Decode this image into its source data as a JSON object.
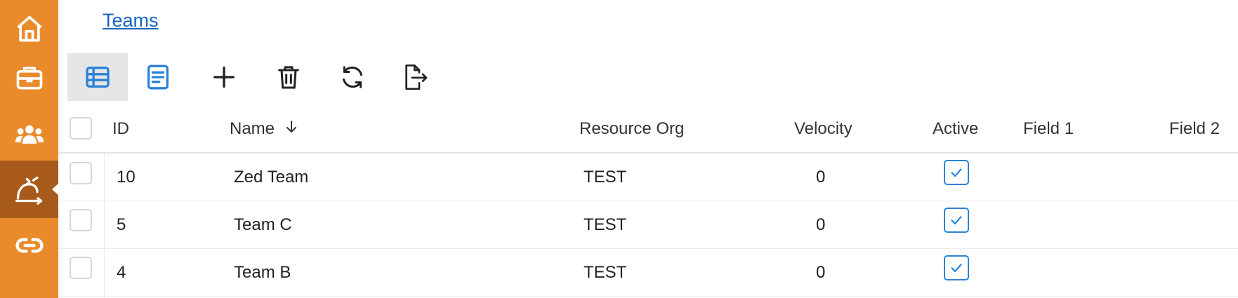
{
  "sidebar": {
    "bg_color": "#ea8b2b",
    "active_color": "#a85a1b",
    "items": [
      {
        "icon": "home-icon"
      },
      {
        "icon": "briefcase-icon"
      },
      {
        "icon": "users-icon"
      },
      {
        "icon": "workflow-icon",
        "active": true
      },
      {
        "icon": "link-icon"
      }
    ]
  },
  "breadcrumb": {
    "label": "Teams"
  },
  "toolbar": {
    "buttons": [
      {
        "icon": "table-view-icon",
        "active": true
      },
      {
        "icon": "form-view-icon"
      },
      {
        "icon": "add-icon"
      },
      {
        "icon": "delete-icon"
      },
      {
        "icon": "refresh-icon"
      },
      {
        "icon": "export-icon"
      }
    ]
  },
  "table": {
    "columns": {
      "id": "ID",
      "name": "Name",
      "resource_org": "Resource Org",
      "velocity": "Velocity",
      "active": "Active",
      "field1": "Field 1",
      "field2": "Field 2"
    },
    "sort": {
      "column": "name",
      "direction": "descending",
      "icon": "arrow-down-icon"
    },
    "rows": [
      {
        "id": "10",
        "name": "Zed Team",
        "resource_org": "TEST",
        "velocity": "0",
        "active": true
      },
      {
        "id": "5",
        "name": "Team C",
        "resource_org": "TEST",
        "velocity": "0",
        "active": true
      },
      {
        "id": "4",
        "name": "Team B",
        "resource_org": "TEST",
        "velocity": "0",
        "active": true
      }
    ]
  },
  "colors": {
    "accent": "#2a83d6",
    "link": "#1565c0"
  }
}
